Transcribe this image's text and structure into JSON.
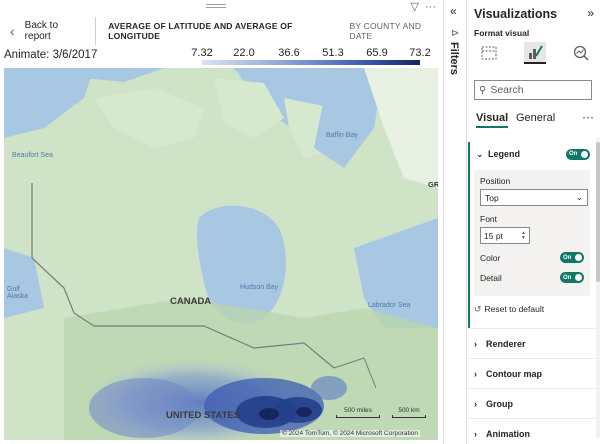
{
  "header": {
    "back_label": "Back to report",
    "title": "AVERAGE OF LATITUDE AND AVERAGE OF LONGITUDE",
    "subtitle": "BY COUNTY AND DATE"
  },
  "animate_label": "Animate: 3/6/2017",
  "legend_ticks": [
    "7.32",
    "22.0",
    "36.6",
    "51.3",
    "65.9",
    "73.2"
  ],
  "map": {
    "labels": {
      "beaufort": "Beaufort Sea",
      "baffin": "Baffin Bay",
      "hudson": "Hudson Bay",
      "labrador": "Labrador Sea",
      "gulf": "Gulf\nAlaska",
      "canada": "CANADA",
      "us": "UNITED STATES",
      "edge": "GRI"
    },
    "scale_miles": "500 miles",
    "scale_km": "500 km",
    "copyright": "© 2024 TomTom, © 2024 Microsoft Corporation"
  },
  "filters": {
    "label": "Filters"
  },
  "pane": {
    "title": "Visualizations",
    "subtitle": "Format visual",
    "search_placeholder": "Search",
    "tabs": [
      "Visual",
      "General"
    ],
    "legend_section": {
      "label": "Legend",
      "toggle": "On",
      "position_label": "Position",
      "position_value": "Top",
      "font_label": "Font",
      "font_value": "15 pt",
      "color_label": "Color",
      "color_toggle": "On",
      "detail_label": "Detail",
      "detail_toggle": "On"
    },
    "reset_label": "Reset to default",
    "sections": [
      "Renderer",
      "Contour map",
      "Group",
      "Animation"
    ]
  },
  "colors": {
    "accent": "#117865",
    "map_water": "#a7c7e3",
    "map_land": "#cfe3c6",
    "heat_dark": "#14265e"
  }
}
